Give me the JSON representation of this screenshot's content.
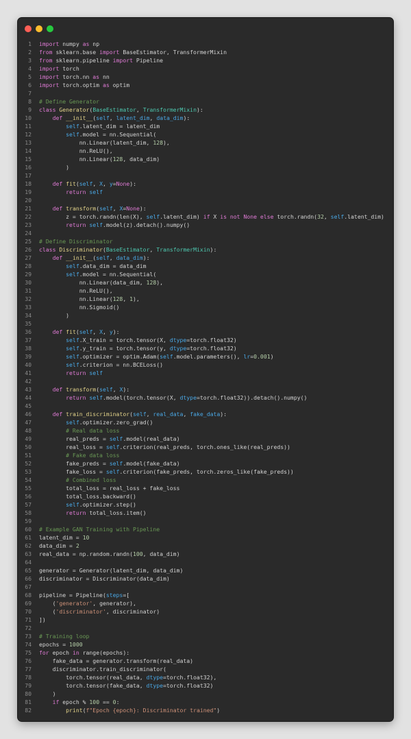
{
  "window": {
    "controls": [
      "close",
      "minimize",
      "maximize"
    ]
  },
  "editor": {
    "lines": [
      [
        [
          "k",
          "import"
        ],
        [
          "t",
          " numpy "
        ],
        [
          "k",
          "as"
        ],
        [
          "t",
          " np"
        ]
      ],
      [
        [
          "k",
          "from"
        ],
        [
          "t",
          " sklearn.base "
        ],
        [
          "k",
          "import"
        ],
        [
          "t",
          " BaseEstimator, TransformerMixin"
        ]
      ],
      [
        [
          "k",
          "from"
        ],
        [
          "t",
          " sklearn.pipeline "
        ],
        [
          "k",
          "import"
        ],
        [
          "t",
          " Pipeline"
        ]
      ],
      [
        [
          "k",
          "import"
        ],
        [
          "t",
          " torch"
        ]
      ],
      [
        [
          "k",
          "import"
        ],
        [
          "t",
          " torch.nn "
        ],
        [
          "k",
          "as"
        ],
        [
          "t",
          " nn"
        ]
      ],
      [
        [
          "k",
          "import"
        ],
        [
          "t",
          " torch.optim "
        ],
        [
          "k",
          "as"
        ],
        [
          "t",
          " optim"
        ]
      ],
      [],
      [
        [
          "c",
          "# Define Generator"
        ]
      ],
      [
        [
          "k",
          "class"
        ],
        [
          "t",
          " "
        ],
        [
          "f",
          "Generator"
        ],
        [
          "t",
          "("
        ],
        [
          "cls",
          "BaseEstimator"
        ],
        [
          "t",
          ", "
        ],
        [
          "cls",
          "TransformerMixin"
        ],
        [
          "t",
          "):"
        ]
      ],
      [
        [
          "t",
          "    "
        ],
        [
          "k",
          "def"
        ],
        [
          "t",
          " "
        ],
        [
          "f",
          "__init__"
        ],
        [
          "t",
          "("
        ],
        [
          "self",
          "self"
        ],
        [
          "t",
          ", "
        ],
        [
          "p",
          "latent_dim"
        ],
        [
          "t",
          ", "
        ],
        [
          "p",
          "data_dim"
        ],
        [
          "t",
          "):"
        ]
      ],
      [
        [
          "t",
          "        "
        ],
        [
          "self",
          "self"
        ],
        [
          "t",
          ".latent_dim = latent_dim"
        ]
      ],
      [
        [
          "t",
          "        "
        ],
        [
          "self",
          "self"
        ],
        [
          "t",
          ".model = nn.Sequential("
        ]
      ],
      [
        [
          "t",
          "            nn.Linear(latent_dim, "
        ],
        [
          "n",
          "128"
        ],
        [
          "t",
          "),"
        ]
      ],
      [
        [
          "t",
          "            nn.ReLU(),"
        ]
      ],
      [
        [
          "t",
          "            nn.Linear("
        ],
        [
          "n",
          "128"
        ],
        [
          "t",
          ", data_dim)"
        ]
      ],
      [
        [
          "t",
          "        )"
        ]
      ],
      [],
      [
        [
          "t",
          "    "
        ],
        [
          "k",
          "def"
        ],
        [
          "t",
          " "
        ],
        [
          "f",
          "fit"
        ],
        [
          "t",
          "("
        ],
        [
          "self",
          "self"
        ],
        [
          "t",
          ", "
        ],
        [
          "p",
          "X"
        ],
        [
          "t",
          ", "
        ],
        [
          "p",
          "y"
        ],
        [
          "t",
          "="
        ],
        [
          "k",
          "None"
        ],
        [
          "t",
          "):"
        ]
      ],
      [
        [
          "t",
          "        "
        ],
        [
          "k",
          "return"
        ],
        [
          "t",
          " "
        ],
        [
          "self",
          "self"
        ]
      ],
      [],
      [
        [
          "t",
          "    "
        ],
        [
          "k",
          "def"
        ],
        [
          "t",
          " "
        ],
        [
          "f",
          "transform"
        ],
        [
          "t",
          "("
        ],
        [
          "self",
          "self"
        ],
        [
          "t",
          ", "
        ],
        [
          "p",
          "X"
        ],
        [
          "t",
          "="
        ],
        [
          "k",
          "None"
        ],
        [
          "t",
          "):"
        ]
      ],
      [
        [
          "t",
          "        z = torch.randn(len(X), "
        ],
        [
          "self",
          "self"
        ],
        [
          "t",
          ".latent_dim) "
        ],
        [
          "k",
          "if"
        ],
        [
          "t",
          " X "
        ],
        [
          "k",
          "is not None else"
        ],
        [
          "t",
          " torch.randn("
        ],
        [
          "n",
          "32"
        ],
        [
          "t",
          ", "
        ],
        [
          "self",
          "self"
        ],
        [
          "t",
          ".latent_dim)"
        ]
      ],
      [
        [
          "t",
          "        "
        ],
        [
          "k",
          "return"
        ],
        [
          "t",
          " "
        ],
        [
          "self",
          "self"
        ],
        [
          "t",
          ".model(z).detach().numpy()"
        ]
      ],
      [],
      [
        [
          "c",
          "# Define Discriminator"
        ]
      ],
      [
        [
          "k",
          "class"
        ],
        [
          "t",
          " "
        ],
        [
          "f",
          "Discriminator"
        ],
        [
          "t",
          "("
        ],
        [
          "cls",
          "BaseEstimator"
        ],
        [
          "t",
          ", "
        ],
        [
          "cls",
          "TransformerMixin"
        ],
        [
          "t",
          "):"
        ]
      ],
      [
        [
          "t",
          "    "
        ],
        [
          "k",
          "def"
        ],
        [
          "t",
          " "
        ],
        [
          "f",
          "__init__"
        ],
        [
          "t",
          "("
        ],
        [
          "self",
          "self"
        ],
        [
          "t",
          ", "
        ],
        [
          "p",
          "data_dim"
        ],
        [
          "t",
          "):"
        ]
      ],
      [
        [
          "t",
          "        "
        ],
        [
          "self",
          "self"
        ],
        [
          "t",
          ".data_dim = data_dim"
        ]
      ],
      [
        [
          "t",
          "        "
        ],
        [
          "self",
          "self"
        ],
        [
          "t",
          ".model = nn.Sequential("
        ]
      ],
      [
        [
          "t",
          "            nn.Linear(data_dim, "
        ],
        [
          "n",
          "128"
        ],
        [
          "t",
          "),"
        ]
      ],
      [
        [
          "t",
          "            nn.ReLU(),"
        ]
      ],
      [
        [
          "t",
          "            nn.Linear("
        ],
        [
          "n",
          "128"
        ],
        [
          "t",
          ", "
        ],
        [
          "n",
          "1"
        ],
        [
          "t",
          "),"
        ]
      ],
      [
        [
          "t",
          "            nn.Sigmoid()"
        ]
      ],
      [
        [
          "t",
          "        )"
        ]
      ],
      [],
      [
        [
          "t",
          "    "
        ],
        [
          "k",
          "def"
        ],
        [
          "t",
          " "
        ],
        [
          "f",
          "fit"
        ],
        [
          "t",
          "("
        ],
        [
          "self",
          "self"
        ],
        [
          "t",
          ", "
        ],
        [
          "p",
          "X"
        ],
        [
          "t",
          ", "
        ],
        [
          "p",
          "y"
        ],
        [
          "t",
          "):"
        ]
      ],
      [
        [
          "t",
          "        "
        ],
        [
          "self",
          "self"
        ],
        [
          "t",
          ".X_train = torch.tensor(X, "
        ],
        [
          "p",
          "dtype"
        ],
        [
          "t",
          "=torch.float32)"
        ]
      ],
      [
        [
          "t",
          "        "
        ],
        [
          "self",
          "self"
        ],
        [
          "t",
          ".y_train = torch.tensor(y, "
        ],
        [
          "p",
          "dtype"
        ],
        [
          "t",
          "=torch.float32)"
        ]
      ],
      [
        [
          "t",
          "        "
        ],
        [
          "self",
          "self"
        ],
        [
          "t",
          ".optimizer = optim.Adam("
        ],
        [
          "self",
          "self"
        ],
        [
          "t",
          ".model.parameters(), "
        ],
        [
          "p",
          "lr"
        ],
        [
          "t",
          "="
        ],
        [
          "n",
          "0.001"
        ],
        [
          "t",
          ")"
        ]
      ],
      [
        [
          "t",
          "        "
        ],
        [
          "self",
          "self"
        ],
        [
          "t",
          ".criterion = nn.BCELoss()"
        ]
      ],
      [
        [
          "t",
          "        "
        ],
        [
          "k",
          "return"
        ],
        [
          "t",
          " "
        ],
        [
          "self",
          "self"
        ]
      ],
      [],
      [
        [
          "t",
          "    "
        ],
        [
          "k",
          "def"
        ],
        [
          "t",
          " "
        ],
        [
          "f",
          "transform"
        ],
        [
          "t",
          "("
        ],
        [
          "self",
          "self"
        ],
        [
          "t",
          ", "
        ],
        [
          "p",
          "X"
        ],
        [
          "t",
          "):"
        ]
      ],
      [
        [
          "t",
          "        "
        ],
        [
          "k",
          "return"
        ],
        [
          "t",
          " "
        ],
        [
          "self",
          "self"
        ],
        [
          "t",
          ".model(torch.tensor(X, "
        ],
        [
          "p",
          "dtype"
        ],
        [
          "t",
          "=torch.float32)).detach().numpy()"
        ]
      ],
      [],
      [
        [
          "t",
          "    "
        ],
        [
          "k",
          "def"
        ],
        [
          "t",
          " "
        ],
        [
          "f",
          "train_discriminator"
        ],
        [
          "t",
          "("
        ],
        [
          "self",
          "self"
        ],
        [
          "t",
          ", "
        ],
        [
          "p",
          "real_data"
        ],
        [
          "t",
          ", "
        ],
        [
          "p",
          "fake_data"
        ],
        [
          "t",
          "):"
        ]
      ],
      [
        [
          "t",
          "        "
        ],
        [
          "self",
          "self"
        ],
        [
          "t",
          ".optimizer.zero_grad()"
        ]
      ],
      [
        [
          "t",
          "        "
        ],
        [
          "c",
          "# Real data loss"
        ]
      ],
      [
        [
          "t",
          "        real_preds = "
        ],
        [
          "self",
          "self"
        ],
        [
          "t",
          ".model(real_data)"
        ]
      ],
      [
        [
          "t",
          "        real_loss = "
        ],
        [
          "self",
          "self"
        ],
        [
          "t",
          ".criterion(real_preds, torch.ones_like(real_preds))"
        ]
      ],
      [
        [
          "t",
          "        "
        ],
        [
          "c",
          "# Fake data loss"
        ]
      ],
      [
        [
          "t",
          "        fake_preds = "
        ],
        [
          "self",
          "self"
        ],
        [
          "t",
          ".model(fake_data)"
        ]
      ],
      [
        [
          "t",
          "        fake_loss = "
        ],
        [
          "self",
          "self"
        ],
        [
          "t",
          ".criterion(fake_preds, torch.zeros_like(fake_preds))"
        ]
      ],
      [
        [
          "t",
          "        "
        ],
        [
          "c",
          "# Combined loss"
        ]
      ],
      [
        [
          "t",
          "        total_loss = real_loss + fake_loss"
        ]
      ],
      [
        [
          "t",
          "        total_loss.backward()"
        ]
      ],
      [
        [
          "t",
          "        "
        ],
        [
          "self",
          "self"
        ],
        [
          "t",
          ".optimizer.step()"
        ]
      ],
      [
        [
          "t",
          "        "
        ],
        [
          "k",
          "return"
        ],
        [
          "t",
          " total_loss.item()"
        ]
      ],
      [],
      [
        [
          "c",
          "# Example GAN Training with Pipeline"
        ]
      ],
      [
        [
          "t",
          "latent_dim = "
        ],
        [
          "n",
          "10"
        ]
      ],
      [
        [
          "t",
          "data_dim = "
        ],
        [
          "n",
          "2"
        ]
      ],
      [
        [
          "t",
          "real_data = np.random.randn("
        ],
        [
          "n",
          "100"
        ],
        [
          "t",
          ", data_dim)"
        ]
      ],
      [],
      [
        [
          "t",
          "generator = Generator(latent_dim, data_dim)"
        ]
      ],
      [
        [
          "t",
          "discriminator = Discriminator(data_dim)"
        ]
      ],
      [],
      [
        [
          "t",
          "pipeline = Pipeline("
        ],
        [
          "p",
          "steps"
        ],
        [
          "t",
          "=["
        ]
      ],
      [
        [
          "t",
          "    ("
        ],
        [
          "s",
          "'generator'"
        ],
        [
          "t",
          ", generator),"
        ]
      ],
      [
        [
          "t",
          "    ("
        ],
        [
          "s",
          "'discriminator'"
        ],
        [
          "t",
          ", discriminator)"
        ]
      ],
      [
        [
          "t",
          "])"
        ]
      ],
      [],
      [
        [
          "c",
          "# Training loop"
        ]
      ],
      [
        [
          "t",
          "epochs = "
        ],
        [
          "n",
          "1000"
        ]
      ],
      [
        [
          "k",
          "for"
        ],
        [
          "t",
          " epoch "
        ],
        [
          "k",
          "in"
        ],
        [
          "t",
          " range(epochs):"
        ]
      ],
      [
        [
          "t",
          "    fake_data = generator.transform(real_data)"
        ]
      ],
      [
        [
          "t",
          "    discriminator.train_discriminator("
        ]
      ],
      [
        [
          "t",
          "        torch.tensor(real_data, "
        ],
        [
          "p",
          "dtype"
        ],
        [
          "t",
          "=torch.float32),"
        ]
      ],
      [
        [
          "t",
          "        torch.tensor(fake_data, "
        ],
        [
          "p",
          "dtype"
        ],
        [
          "t",
          "=torch.float32)"
        ]
      ],
      [
        [
          "t",
          "    )"
        ]
      ],
      [
        [
          "t",
          "    "
        ],
        [
          "k",
          "if"
        ],
        [
          "t",
          " epoch % "
        ],
        [
          "n",
          "100"
        ],
        [
          "t",
          " == "
        ],
        [
          "n",
          "0"
        ],
        [
          "t",
          ":"
        ]
      ],
      [
        [
          "t",
          "        "
        ],
        [
          "f",
          "print"
        ],
        [
          "t",
          "("
        ],
        [
          "s",
          "f\"Epoch {epoch}: Discriminator trained\""
        ],
        [
          "t",
          ")"
        ]
      ]
    ]
  }
}
